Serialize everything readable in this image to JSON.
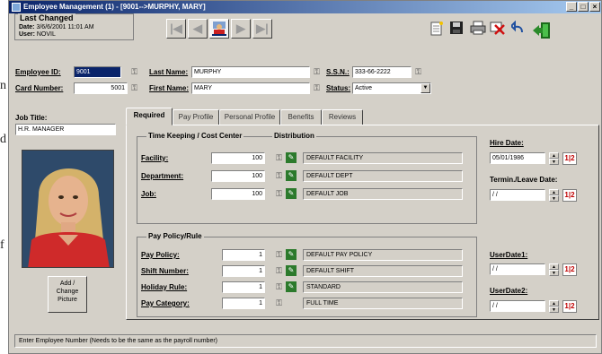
{
  "left_fragments": [
    "n",
    "d",
    "f"
  ],
  "window": {
    "title": "Employee Management (1) - [9001-->MURPHY, MARY]",
    "buttons": [
      "_",
      "□",
      "×"
    ]
  },
  "last_changed": {
    "header": "Last Changed",
    "date_label": "Date:",
    "date_value": "3/6/6/2001 11:01 AM",
    "user_label": "User:",
    "user_value": "NOVIL"
  },
  "nav": [
    "|◀",
    "◀",
    "▶",
    "▶|"
  ],
  "toolbar_icons": [
    "new-doc-icon",
    "save-icon",
    "print-icon",
    "delete-icon",
    "undo-icon",
    "exit-icon"
  ],
  "fields": {
    "employee_id_label": "Employee ID:",
    "employee_id_value": "9001",
    "card_number_label": "Card Number:",
    "card_number_value": "5001",
    "last_name_label": "Last Name:",
    "last_name_value": "MURPHY",
    "first_name_label": "First Name:",
    "first_name_value": "MARY",
    "ssn_label": "S.S.N.:",
    "ssn_value": "333-66-2222",
    "status_label": "Status:",
    "status_value": "Active"
  },
  "job_title": {
    "label": "Job Title:",
    "value": "H.R. MANAGER"
  },
  "picture_button": "Add / Change Picture",
  "tabs": [
    "Required",
    "Pay Profile",
    "Personal Profile",
    "Benefits",
    "Reviews"
  ],
  "timekeeping": {
    "header": "Time Keeping / Cost Center",
    "dist_header": "Distribution",
    "rows": [
      {
        "label": "Facility:",
        "value": "100",
        "desc": "DEFAULT FACILITY"
      },
      {
        "label": "Department:",
        "value": "100",
        "desc": "DEFAULT DEPT"
      },
      {
        "label": "Job:",
        "value": "100",
        "desc": "DEFAULT JOB"
      }
    ]
  },
  "pay_policy": {
    "header": "Pay Policy/Rule",
    "rows": [
      {
        "label": "Pay Policy:",
        "value": "1",
        "desc": "DEFAULT PAY POLICY"
      },
      {
        "label": "Shift Number:",
        "value": "1",
        "desc": "DEFAULT SHIFT"
      },
      {
        "label": "Holiday Rule:",
        "value": "1",
        "desc": "STANDARD"
      },
      {
        "label": "Pay Category:",
        "value": "1",
        "desc": "FULL TIME"
      }
    ]
  },
  "dates": {
    "hire_label": "Hire Date:",
    "hire_value": "05/01/1986",
    "termin_label": "Termin./Leave Date:",
    "termin_value": "/ /",
    "user1_label": "UserDate1:",
    "user1_value": "/ /",
    "user2_label": "UserDate2:",
    "user2_value": "/ /",
    "cal_glyph": "1|2"
  },
  "status_bar": "Enter Employee Number (Needs to be the same as the payroll number)"
}
